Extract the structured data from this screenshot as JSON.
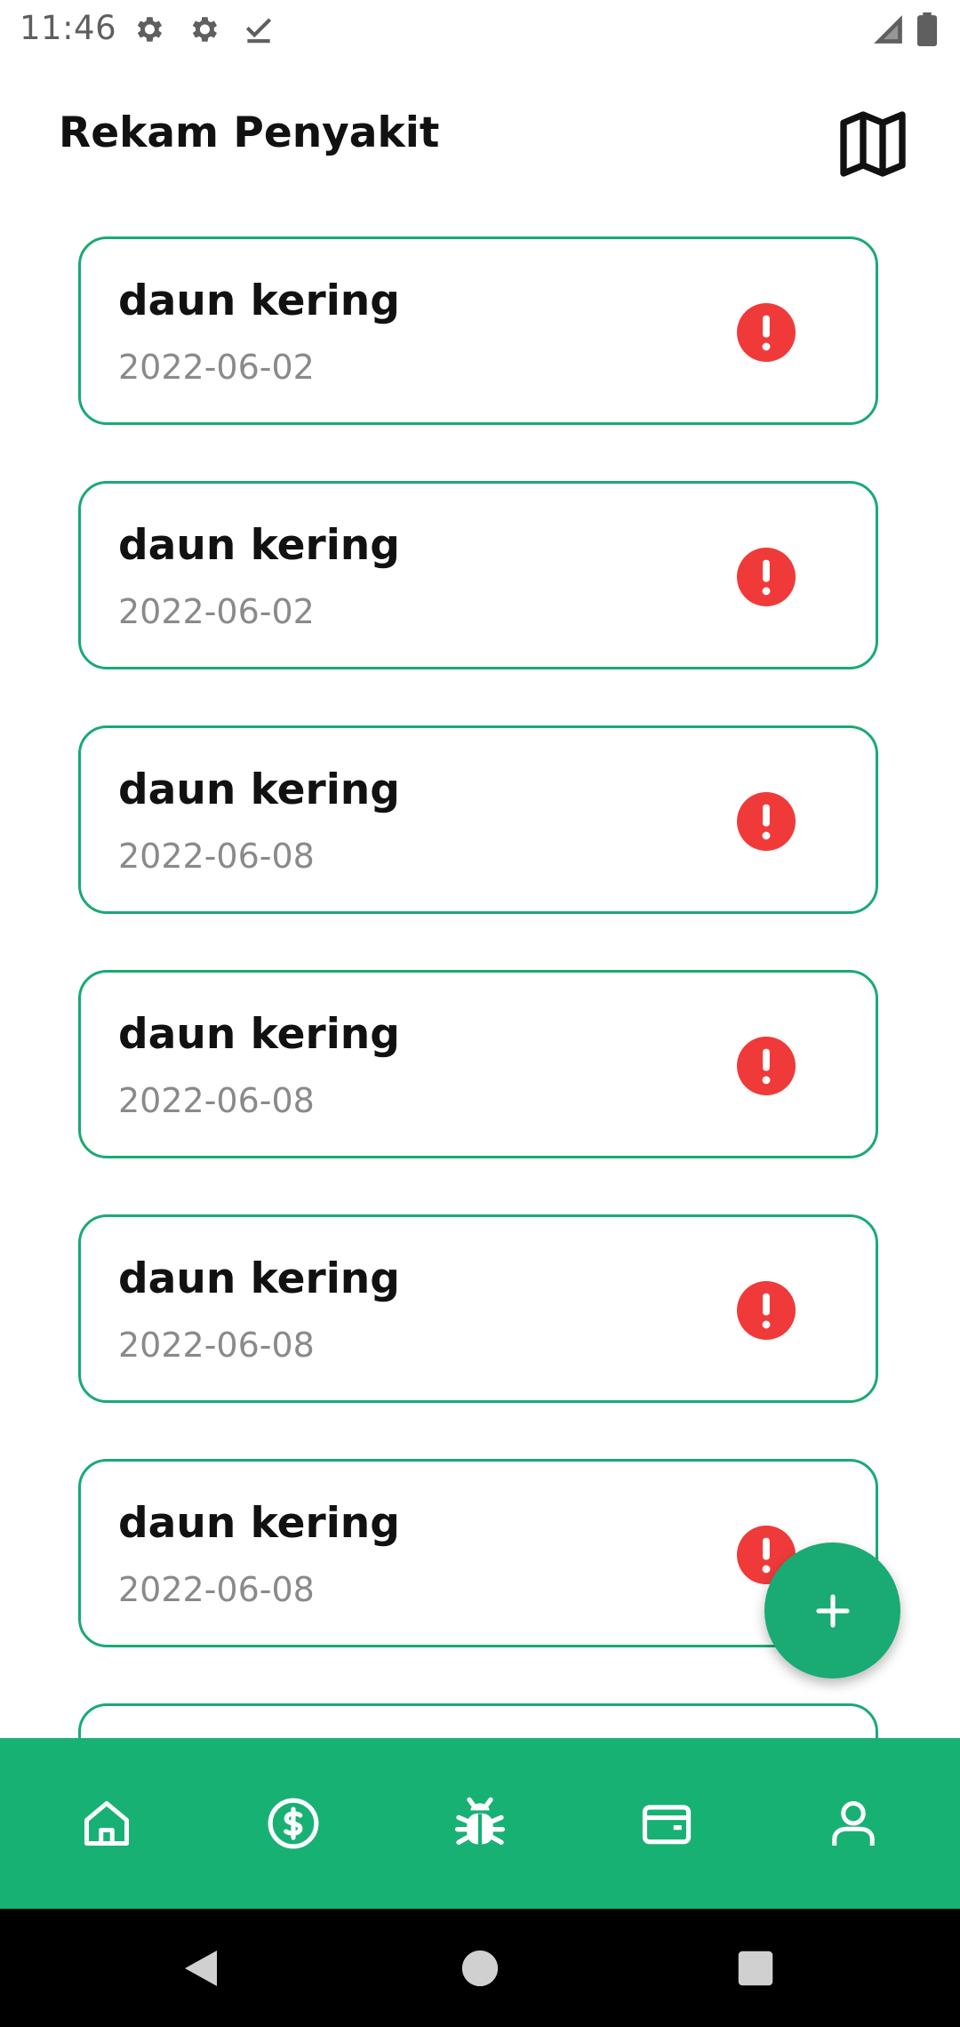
{
  "status_bar": {
    "time": "11:46",
    "icons": [
      "settings-icon",
      "settings-icon",
      "download-done-icon",
      "signal-icon",
      "battery-icon"
    ]
  },
  "header": {
    "title": "Rekam Penyakit",
    "map_icon": "map-icon"
  },
  "records": [
    {
      "name": "daun kering",
      "date": "2022-06-02",
      "status_icon": "alert-icon"
    },
    {
      "name": "daun kering",
      "date": "2022-06-02",
      "status_icon": "alert-icon"
    },
    {
      "name": "daun kering",
      "date": "2022-06-08",
      "status_icon": "alert-icon"
    },
    {
      "name": "daun kering",
      "date": "2022-06-08",
      "status_icon": "alert-icon"
    },
    {
      "name": "daun kering",
      "date": "2022-06-08",
      "status_icon": "alert-icon"
    },
    {
      "name": "daun kering",
      "date": "2022-06-08",
      "status_icon": "alert-icon"
    }
  ],
  "fab": {
    "icon": "plus-icon"
  },
  "bottom_nav": {
    "items": [
      "home-icon",
      "dollar-icon",
      "bug-icon",
      "wallet-icon",
      "profile-icon"
    ],
    "active": "bug-icon"
  },
  "system_nav": [
    "back-icon",
    "home-circle-icon",
    "recents-icon"
  ],
  "colors": {
    "accent": "#1aaa74",
    "nav_background": "#18b174",
    "alert": "#f03a3a",
    "text_primary": "#111111",
    "text_secondary": "#8a8a8a"
  }
}
